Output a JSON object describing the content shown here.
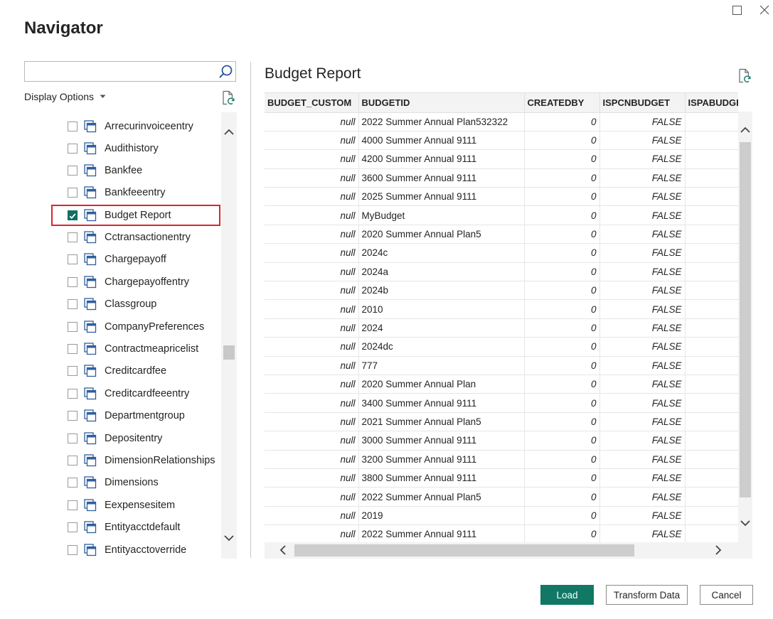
{
  "dialog": {
    "title": "Navigator"
  },
  "search": {
    "value": "",
    "placeholder": ""
  },
  "display_options": {
    "label": "Display Options"
  },
  "nav_items": [
    {
      "label": "Arrecurinvoiceentry",
      "checked": false
    },
    {
      "label": "Audithistory",
      "checked": false
    },
    {
      "label": "Bankfee",
      "checked": false
    },
    {
      "label": "Bankfeeentry",
      "checked": false
    },
    {
      "label": "Budget Report",
      "checked": true
    },
    {
      "label": "Cctransactionentry",
      "checked": false
    },
    {
      "label": "Chargepayoff",
      "checked": false
    },
    {
      "label": "Chargepayoffentry",
      "checked": false
    },
    {
      "label": "Classgroup",
      "checked": false
    },
    {
      "label": "CompanyPreferences",
      "checked": false
    },
    {
      "label": "Contractmeapricelist",
      "checked": false
    },
    {
      "label": "Creditcardfee",
      "checked": false
    },
    {
      "label": "Creditcardfeeentry",
      "checked": false
    },
    {
      "label": "Departmentgroup",
      "checked": false
    },
    {
      "label": "Depositentry",
      "checked": false
    },
    {
      "label": "DimensionRelationships",
      "checked": false
    },
    {
      "label": "Dimensions",
      "checked": false
    },
    {
      "label": "Eexpensesitem",
      "checked": false
    },
    {
      "label": "Entityacctdefault",
      "checked": false
    },
    {
      "label": "Entityacctoverride",
      "checked": false
    }
  ],
  "preview": {
    "title": "Budget Report",
    "columns": [
      "BUDGET_CUSTOM",
      "BUDGETID",
      "CREATEDBY",
      "ISPCNBUDGET",
      "ISPABUDGET"
    ],
    "rows": [
      [
        "null",
        "2022 Summer Annual Plan532322",
        "0",
        "FALSE",
        ""
      ],
      [
        "null",
        "4000 Summer Annual 9111",
        "0",
        "FALSE",
        ""
      ],
      [
        "null",
        "4200 Summer Annual 9111",
        "0",
        "FALSE",
        ""
      ],
      [
        "null",
        "3600 Summer Annual 9111",
        "0",
        "FALSE",
        ""
      ],
      [
        "null",
        "2025 Summer Annual 9111",
        "0",
        "FALSE",
        ""
      ],
      [
        "null",
        "MyBudget",
        "0",
        "FALSE",
        ""
      ],
      [
        "null",
        "2020 Summer Annual Plan5",
        "0",
        "FALSE",
        ""
      ],
      [
        "null",
        "2024c",
        "0",
        "FALSE",
        ""
      ],
      [
        "null",
        "2024a",
        "0",
        "FALSE",
        ""
      ],
      [
        "null",
        "2024b",
        "0",
        "FALSE",
        ""
      ],
      [
        "null",
        "2010",
        "0",
        "FALSE",
        ""
      ],
      [
        "null",
        "2024",
        "0",
        "FALSE",
        ""
      ],
      [
        "null",
        "2024dc",
        "0",
        "FALSE",
        ""
      ],
      [
        "null",
        "777",
        "0",
        "FALSE",
        ""
      ],
      [
        "null",
        "2020 Summer Annual Plan",
        "0",
        "FALSE",
        ""
      ],
      [
        "null",
        "3400 Summer Annual 9111",
        "0",
        "FALSE",
        ""
      ],
      [
        "null",
        "2021 Summer Annual Plan5",
        "0",
        "FALSE",
        ""
      ],
      [
        "null",
        "3000 Summer Annual 9111",
        "0",
        "FALSE",
        ""
      ],
      [
        "null",
        "3200 Summer Annual 9111",
        "0",
        "FALSE",
        ""
      ],
      [
        "null",
        "3800 Summer Annual 9111",
        "0",
        "FALSE",
        ""
      ],
      [
        "null",
        "2022 Summer Annual Plan5",
        "0",
        "FALSE",
        ""
      ],
      [
        "null",
        "2019",
        "0",
        "FALSE",
        ""
      ],
      [
        "null",
        "2022 Summer Annual 9111",
        "0",
        "FALSE",
        ""
      ]
    ]
  },
  "buttons": {
    "load": "Load",
    "transform": "Transform Data",
    "cancel": "Cancel"
  },
  "colors": {
    "accent": "#117865",
    "selection_outline": "#d9252f",
    "table_icon": "#2f5f9e"
  }
}
